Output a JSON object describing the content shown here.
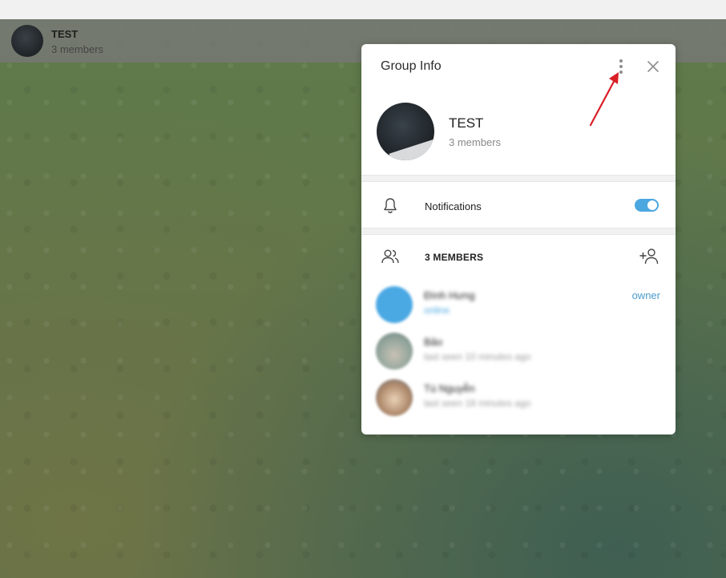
{
  "chat_header": {
    "title": "TEST",
    "subtitle": "3 members"
  },
  "group_info": {
    "title": "Group Info",
    "group_name": "TEST",
    "member_count": "3 members",
    "notifications_label": "Notifications",
    "notifications_enabled": true,
    "members_header": "3 MEMBERS",
    "members": [
      {
        "name": "Đình Hưng",
        "status": "online",
        "role": "owner",
        "avatar_color": "#4aa8e3"
      },
      {
        "name": "Bảo",
        "status": "last seen 10 minutes ago",
        "role": "",
        "avatar_color": "#9aa8a0"
      },
      {
        "name": "Tú Nguyễn",
        "status": "last seen 18 minutes ago",
        "role": "",
        "avatar_color": "#c79a78"
      }
    ]
  },
  "colors": {
    "accent": "#4ba7e0",
    "annotation_arrow": "#d81f26"
  },
  "icons": [
    "more-vertical-icon",
    "close-icon",
    "bell-icon",
    "users-icon",
    "add-user-icon"
  ]
}
